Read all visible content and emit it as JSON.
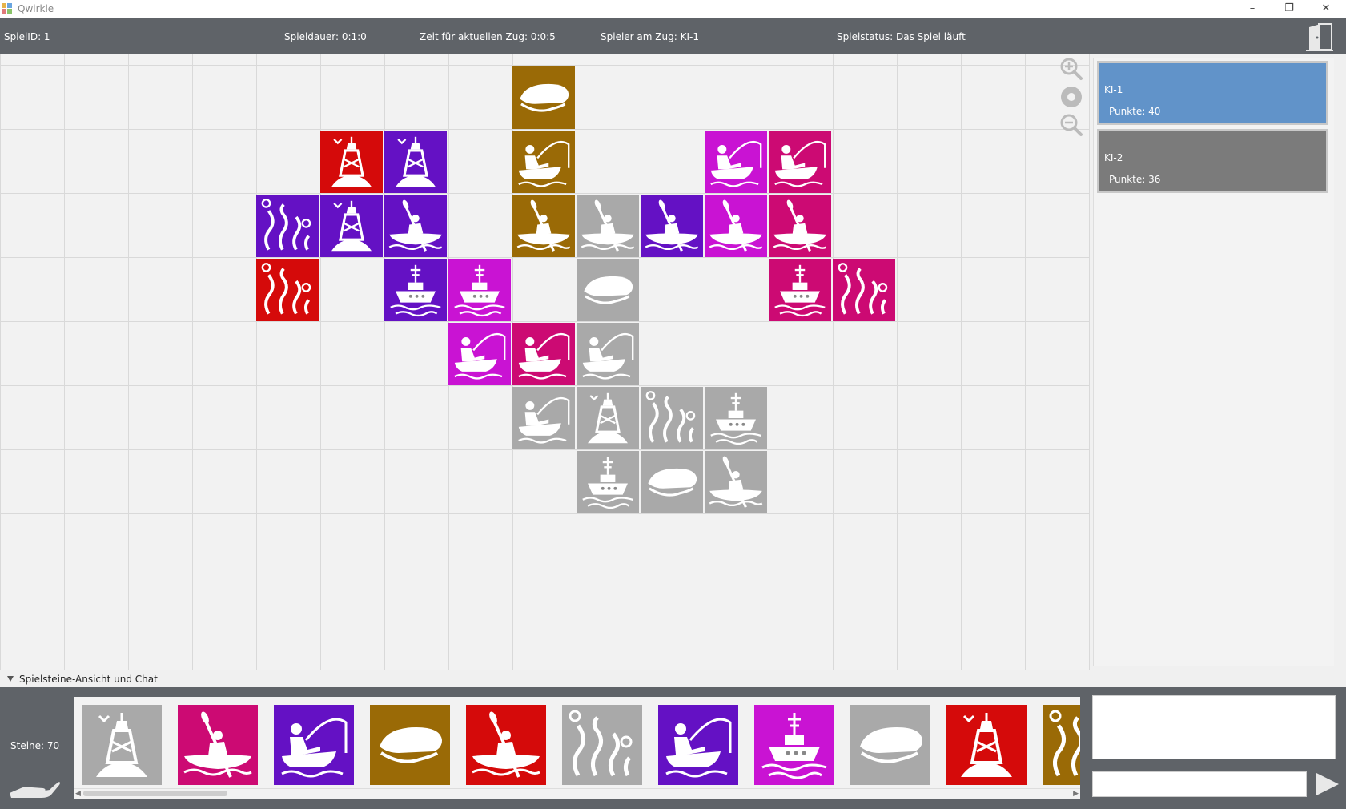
{
  "window": {
    "title": "Qwirkle"
  },
  "infobar": {
    "game_id": "SpielID:  1",
    "duration": "Spieldauer: 0:1:0",
    "turn_time": "Zeit für aktuellen Zug: 0:0:5",
    "current_player": "Spieler am Zug: KI-1",
    "status": "Spielstatus: Das Spiel läuft"
  },
  "colors": {
    "brown": "#9a6a06",
    "red": "#d50a0a",
    "purple": "#6411c4",
    "magenta": "#c913d3",
    "pink": "#cc0a73",
    "gray": "#a9a9a9",
    "board_bg": "#f2f2f2",
    "panel": "#5f6368",
    "active_player": "#6193c9",
    "inactive_player": "#7b7b7b"
  },
  "board": {
    "tiles": [
      {
        "col": 8,
        "row": 1,
        "color": "brown",
        "shape": "cap-icon"
      },
      {
        "col": 5,
        "row": 2,
        "color": "red",
        "shape": "buoy-icon"
      },
      {
        "col": 6,
        "row": 2,
        "color": "purple",
        "shape": "buoy-icon"
      },
      {
        "col": 8,
        "row": 2,
        "color": "brown",
        "shape": "fisherman-icon"
      },
      {
        "col": 11,
        "row": 2,
        "color": "magenta",
        "shape": "fisherman-icon"
      },
      {
        "col": 12,
        "row": 2,
        "color": "pink",
        "shape": "fisherman-icon"
      },
      {
        "col": 4,
        "row": 3,
        "color": "purple",
        "shape": "seaweed-icon"
      },
      {
        "col": 5,
        "row": 3,
        "color": "purple",
        "shape": "buoy-icon"
      },
      {
        "col": 6,
        "row": 3,
        "color": "purple",
        "shape": "kayak-icon"
      },
      {
        "col": 8,
        "row": 3,
        "color": "brown",
        "shape": "kayak-icon"
      },
      {
        "col": 9,
        "row": 3,
        "color": "gray",
        "shape": "kayak-icon"
      },
      {
        "col": 10,
        "row": 3,
        "color": "purple",
        "shape": "kayak-icon"
      },
      {
        "col": 11,
        "row": 3,
        "color": "magenta",
        "shape": "kayak-icon"
      },
      {
        "col": 12,
        "row": 3,
        "color": "pink",
        "shape": "kayak-icon"
      },
      {
        "col": 4,
        "row": 4,
        "color": "red",
        "shape": "seaweed-icon"
      },
      {
        "col": 6,
        "row": 4,
        "color": "purple",
        "shape": "ship-icon"
      },
      {
        "col": 7,
        "row": 4,
        "color": "magenta",
        "shape": "ship-icon"
      },
      {
        "col": 9,
        "row": 4,
        "color": "gray",
        "shape": "cap-icon"
      },
      {
        "col": 12,
        "row": 4,
        "color": "pink",
        "shape": "ship-icon"
      },
      {
        "col": 13,
        "row": 4,
        "color": "pink",
        "shape": "seaweed-icon"
      },
      {
        "col": 7,
        "row": 5,
        "color": "magenta",
        "shape": "fisherman-icon"
      },
      {
        "col": 8,
        "row": 5,
        "color": "pink",
        "shape": "fisherman-icon"
      },
      {
        "col": 9,
        "row": 5,
        "color": "gray",
        "shape": "fisherman-icon"
      },
      {
        "col": 8,
        "row": 6,
        "color": "gray",
        "shape": "fisherman-icon"
      },
      {
        "col": 9,
        "row": 6,
        "color": "gray",
        "shape": "buoy-icon"
      },
      {
        "col": 10,
        "row": 6,
        "color": "gray",
        "shape": "seaweed-icon"
      },
      {
        "col": 11,
        "row": 6,
        "color": "gray",
        "shape": "ship-icon"
      },
      {
        "col": 9,
        "row": 7,
        "color": "gray",
        "shape": "ship-icon"
      },
      {
        "col": 10,
        "row": 7,
        "color": "gray",
        "shape": "cap-icon"
      },
      {
        "col": 11,
        "row": 7,
        "color": "gray",
        "shape": "kayak-icon"
      }
    ]
  },
  "zoom": {
    "in_icon": "zoom-in-icon",
    "reset_icon": "zoom-reset-icon",
    "out_icon": "zoom-out-icon"
  },
  "players": [
    {
      "name": "KI-1",
      "score": "Punkte: 40",
      "active": true
    },
    {
      "name": "KI-2",
      "score": "Punkte: 36",
      "active": false
    }
  ],
  "bottom": {
    "title": "Spielsteine-Ansicht und Chat",
    "stones": "Steine: 70",
    "hand": [
      {
        "color": "gray",
        "shape": "buoy-icon"
      },
      {
        "color": "pink",
        "shape": "kayak-icon"
      },
      {
        "color": "purple",
        "shape": "fisherman-icon"
      },
      {
        "color": "brown",
        "shape": "cap-icon"
      },
      {
        "color": "red",
        "shape": "kayak-icon"
      },
      {
        "color": "gray",
        "shape": "seaweed-icon"
      },
      {
        "color": "purple",
        "shape": "fisherman-icon"
      },
      {
        "color": "magenta",
        "shape": "ship-icon"
      },
      {
        "color": "gray",
        "shape": "cap-icon"
      },
      {
        "color": "red",
        "shape": "buoy-icon"
      },
      {
        "color": "brown",
        "shape": "seaweed-icon"
      }
    ],
    "chat_placeholder": ""
  }
}
